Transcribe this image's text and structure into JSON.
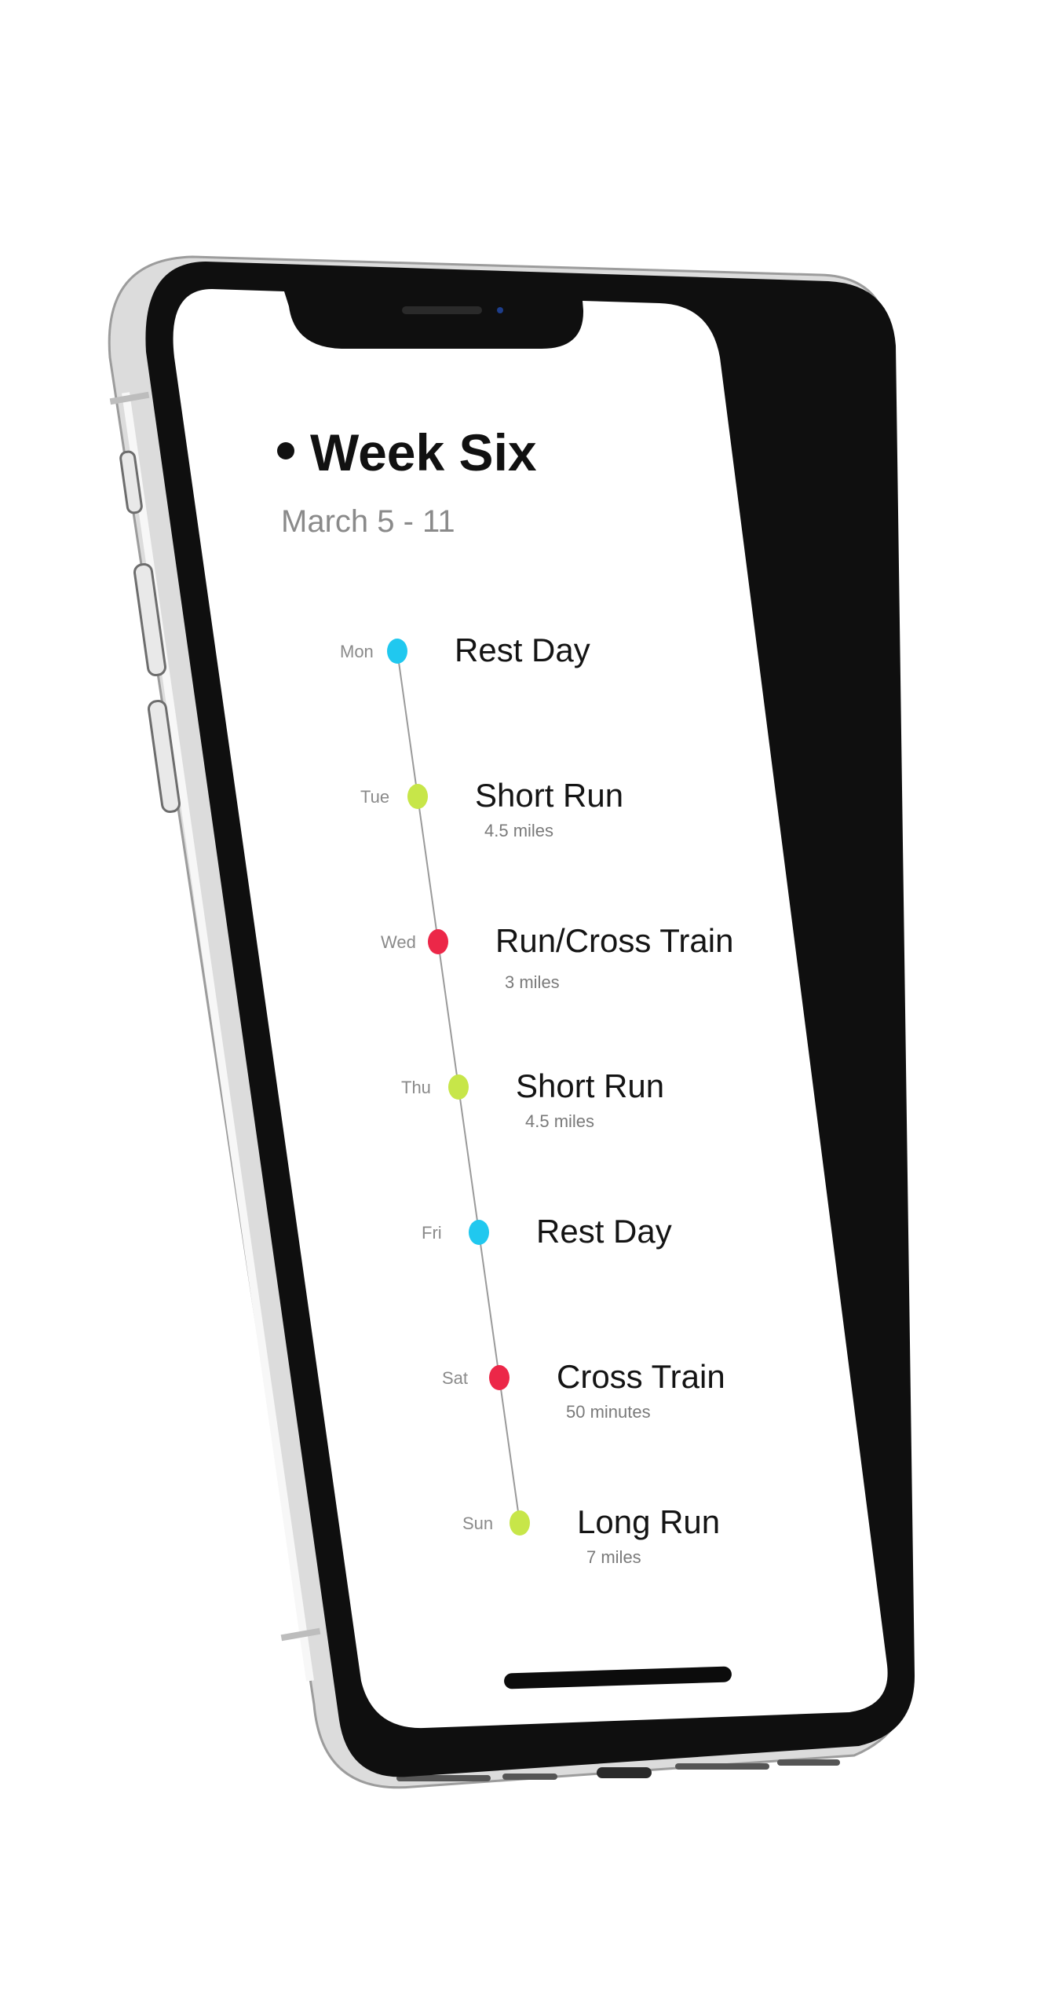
{
  "week": {
    "title": "Week Six",
    "dates": "March 5 - 11"
  },
  "colors": {
    "rest": "#20c8ef",
    "run": "#c7e649",
    "cross": "#ec2748",
    "timeline": "#9a9a9a"
  },
  "days": [
    {
      "day": "Mon",
      "activity": "Rest Day",
      "detail": "",
      "type": "rest"
    },
    {
      "day": "Tue",
      "activity": "Short Run",
      "detail": "4.5 miles",
      "type": "run"
    },
    {
      "day": "Wed",
      "activity": "Run/Cross Train",
      "detail": "3 miles",
      "type": "cross"
    },
    {
      "day": "Thu",
      "activity": "Short Run",
      "detail": "4.5 miles",
      "type": "run"
    },
    {
      "day": "Fri",
      "activity": "Rest Day",
      "detail": "",
      "type": "rest"
    },
    {
      "day": "Sat",
      "activity": "Cross Train",
      "detail": "50 minutes",
      "type": "cross"
    },
    {
      "day": "Sun",
      "activity": "Long Run",
      "detail": "7 miles",
      "type": "run"
    }
  ]
}
